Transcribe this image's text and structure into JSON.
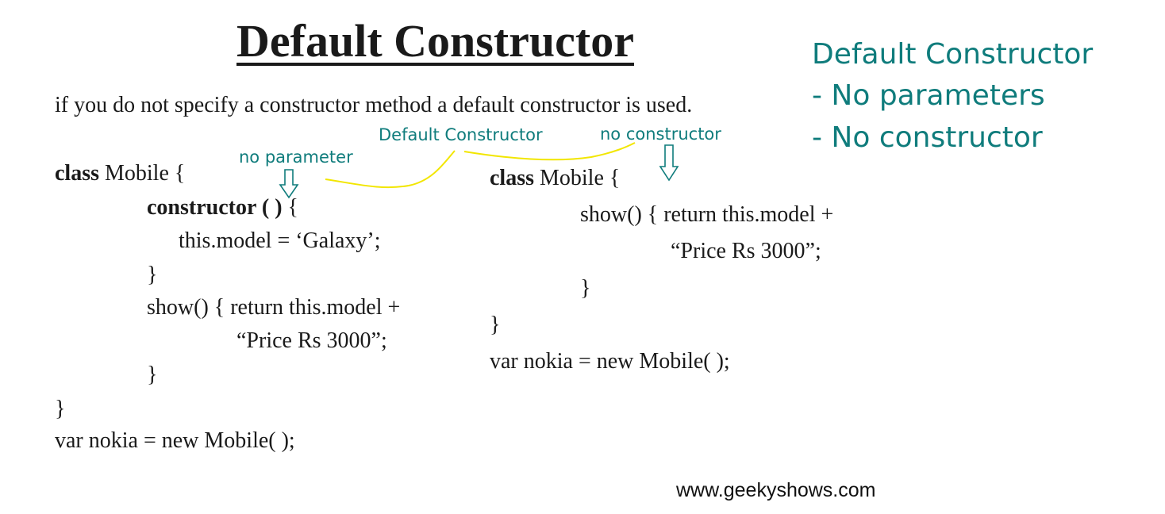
{
  "slide": {
    "title": "Default Constructor",
    "intro": "if you do not specify a constructor method a default constructor is used."
  },
  "code_left": {
    "line1_kw": "class",
    "line1_rest": " Mobile {",
    "line2_kw": "constructor ( )",
    "line2_rest": " {",
    "line3": "this.model = ‘Galaxy’;",
    "line4": "}",
    "line5": "show() { return this.model +",
    "line6": "“Price Rs 3000”;",
    "line7": "}",
    "line8": "}",
    "line9": "var nokia = new Mobile( );"
  },
  "code_right": {
    "line1_kw": "class",
    "line1_rest": " Mobile {",
    "line2": "show() { return this.model +",
    "line3": "“Price Rs 3000”;",
    "line4": "}",
    "line5": "}",
    "line6": "var nokia = new Mobile( );"
  },
  "annotations": {
    "no_parameter": "no parameter",
    "default_constructor": "Default Constructor",
    "no_constructor": "no constructor"
  },
  "side_notes": {
    "heading": "Default Constructor",
    "item1": "- No parameters",
    "item2": "- No constructor"
  },
  "watermark": "www.geekyshows.com",
  "colors": {
    "annotation": "#0f7c7c",
    "highlight_line": "#f2e600",
    "text": "#1a1a1a"
  }
}
